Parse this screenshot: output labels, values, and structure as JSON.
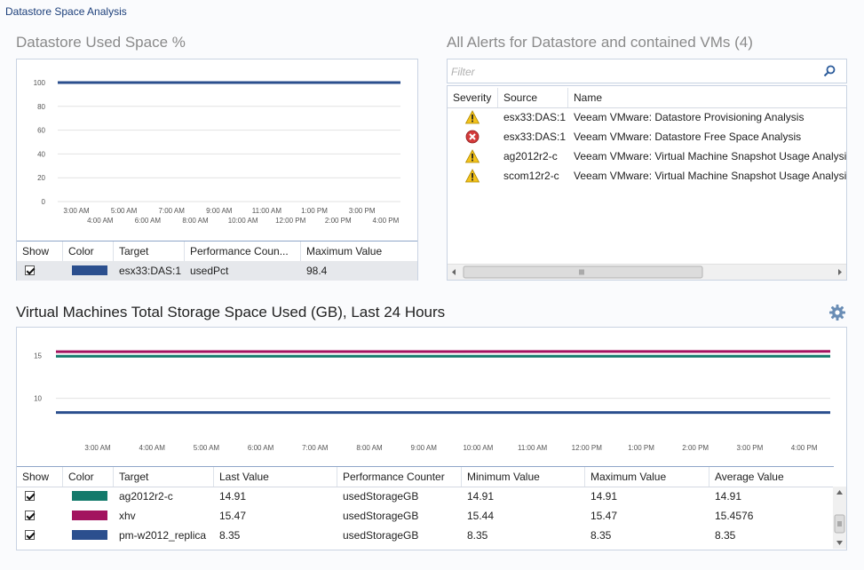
{
  "page": {
    "title": "Datastore Space Analysis"
  },
  "used_space": {
    "title": "Datastore Used Space %",
    "chart_data": {
      "type": "line",
      "ylim": [
        0,
        100
      ],
      "y_ticks": [
        "100",
        "80",
        "60",
        "40",
        "20",
        "0"
      ],
      "x_ticks_upper": [
        "3:00 AM",
        "5:00 AM",
        "7:00 AM",
        "9:00 AM",
        "11:00 AM",
        "1:00 PM",
        "3:00 PM"
      ],
      "x_ticks_lower": [
        "4:00 AM",
        "6:00 AM",
        "8:00 AM",
        "10:00 AM",
        "12:00 PM",
        "2:00 PM",
        "4:00 PM"
      ],
      "series": [
        {
          "name": "esx33:DAS:1",
          "color": "#2b4f8e",
          "values": [
            100,
            100
          ]
        }
      ]
    },
    "table": {
      "headers": [
        "Show",
        "Color",
        "Target",
        "Performance Coun...",
        "Maximum Value"
      ],
      "rows": [
        {
          "target": "esx33:DAS:1",
          "counter": "usedPct",
          "max": "98.4",
          "color": "#2b4f8e"
        }
      ]
    }
  },
  "alerts": {
    "title": "All Alerts for Datastore and contained VMs (4)",
    "filter_placeholder": "Filter",
    "headers": [
      "Severity",
      "Source",
      "Name"
    ],
    "rows": [
      {
        "severity": "warning",
        "source": "esx33:DAS:1",
        "name": "Veeam VMware: Datastore Provisioning Analysis"
      },
      {
        "severity": "critical",
        "source": "esx33:DAS:1",
        "name": "Veeam VMware: Datastore Free Space Analysis"
      },
      {
        "severity": "warning",
        "source": "ag2012r2-c",
        "name": "Veeam VMware: Virtual Machine Snapshot Usage Analysis"
      },
      {
        "severity": "warning",
        "source": "scom12r2-c",
        "name": "Veeam VMware: Virtual Machine Snapshot Usage Analysis"
      }
    ]
  },
  "vm_storage": {
    "title": "Virtual Machines Total Storage Space Used (GB), Last 24 Hours",
    "chart_data": {
      "type": "line",
      "ylim": [
        5,
        17
      ],
      "y_ticks": [
        "15",
        "10"
      ],
      "x_ticks": [
        "3:00 AM",
        "4:00 AM",
        "5:00 AM",
        "6:00 AM",
        "7:00 AM",
        "8:00 AM",
        "9:00 AM",
        "10:00 AM",
        "11:00 AM",
        "12:00 PM",
        "1:00 PM",
        "2:00 PM",
        "3:00 PM",
        "4:00 PM"
      ],
      "series": [
        {
          "name": "ag2012r2-c",
          "color": "#137a6b",
          "values": [
            14.91,
            14.91
          ]
        },
        {
          "name": "xhv",
          "color": "#a3135f",
          "values": [
            15.44,
            15.47
          ]
        },
        {
          "name": "pm-w2012_replica",
          "color": "#2b4f8e",
          "values": [
            8.35,
            8.35
          ]
        }
      ]
    },
    "table": {
      "headers": [
        "Show",
        "Color",
        "Target",
        "Last Value",
        "Performance Counter",
        "Minimum Value",
        "Maximum Value",
        "Average Value"
      ],
      "rows": [
        {
          "target": "ag2012r2-c",
          "last": "14.91",
          "counter": "usedStorageGB",
          "min": "14.91",
          "max": "14.91",
          "avg": "14.91",
          "color": "#137a6b"
        },
        {
          "target": "xhv",
          "last": "15.47",
          "counter": "usedStorageGB",
          "min": "15.44",
          "max": "15.47",
          "avg": "15.4576",
          "color": "#a3135f"
        },
        {
          "target": "pm-w2012_replica",
          "last": "8.35",
          "counter": "usedStorageGB",
          "min": "8.35",
          "max": "8.35",
          "avg": "8.35",
          "color": "#2b4f8e"
        }
      ]
    }
  },
  "icons": [
    "search-icon",
    "warning-icon",
    "critical-icon",
    "gear-icon",
    "checkbox-checked-icon"
  ]
}
